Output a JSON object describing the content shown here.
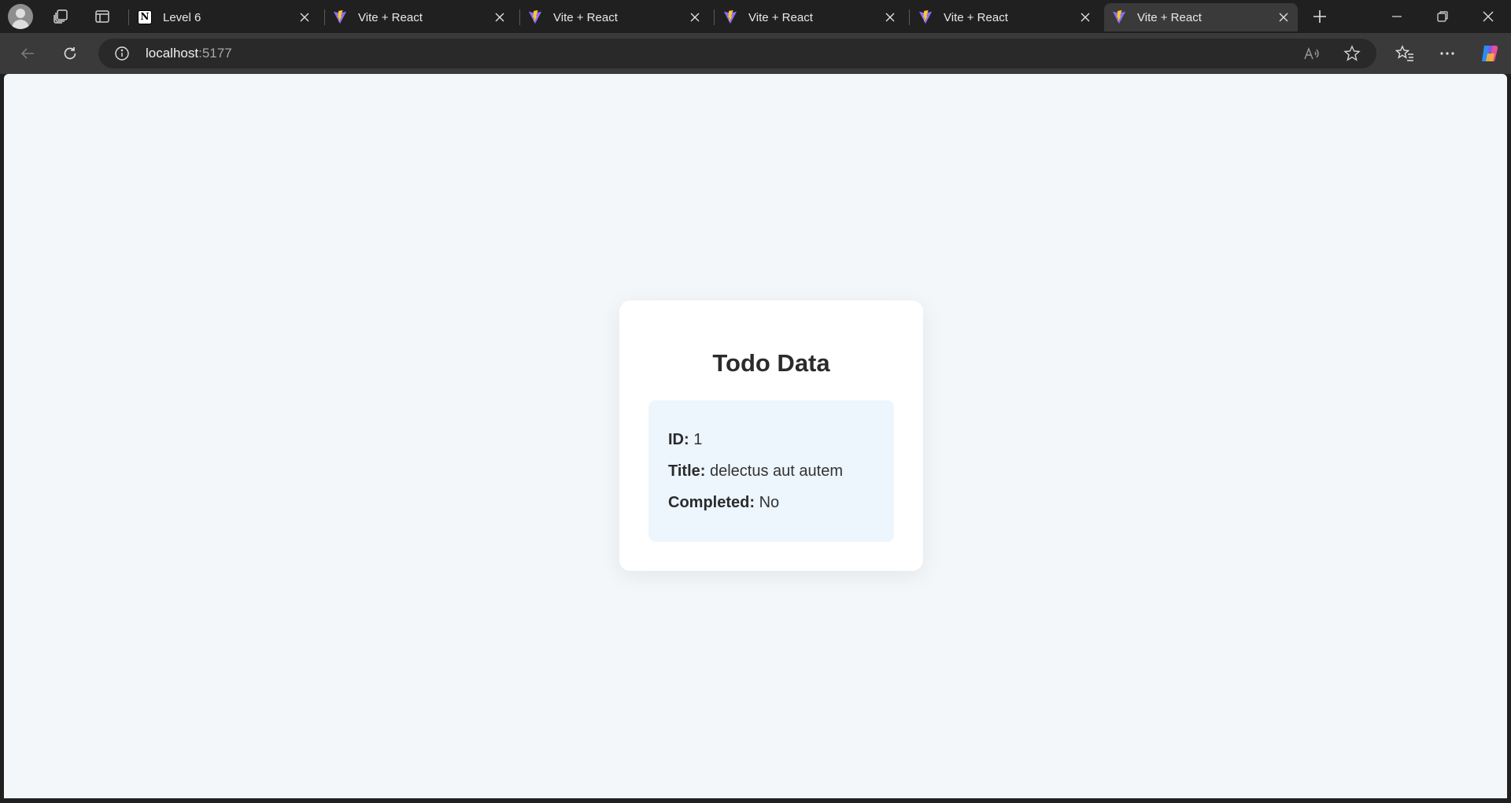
{
  "browser": {
    "tabs": [
      {
        "title": "Level 6",
        "favicon": "notion-icon",
        "active": false
      },
      {
        "title": "Vite + React",
        "favicon": "vite-icon",
        "active": false
      },
      {
        "title": "Vite + React",
        "favicon": "vite-icon",
        "active": false
      },
      {
        "title": "Vite + React",
        "favicon": "vite-icon",
        "active": false
      },
      {
        "title": "Vite + React",
        "favicon": "vite-icon",
        "active": false
      },
      {
        "title": "Vite + React",
        "favicon": "vite-icon",
        "active": true
      }
    ],
    "address": {
      "host": "localhost",
      "port": ":5177"
    },
    "notion_glyph": "N"
  },
  "page": {
    "heading": "Todo Data",
    "fields": [
      {
        "label": "ID:",
        "value": "1"
      },
      {
        "label": "Title:",
        "value": "delectus aut autem"
      },
      {
        "label": "Completed:",
        "value": "No"
      }
    ]
  },
  "colors": {
    "chrome_bg": "#202020",
    "toolbar_bg": "#3a3a3a",
    "page_bg": "#f3f7fa",
    "card_bg": "#ffffff",
    "details_bg": "#edf5fd"
  }
}
